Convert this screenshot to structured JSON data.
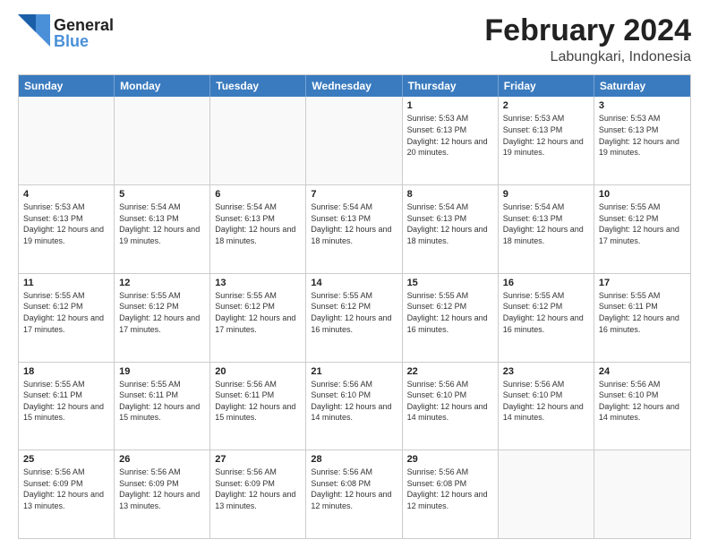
{
  "header": {
    "logo_general": "General",
    "logo_blue": "Blue",
    "month_title": "February 2024",
    "location": "Labungkari, Indonesia"
  },
  "calendar": {
    "days_of_week": [
      "Sunday",
      "Monday",
      "Tuesday",
      "Wednesday",
      "Thursday",
      "Friday",
      "Saturday"
    ],
    "weeks": [
      [
        {
          "day": "",
          "empty": true
        },
        {
          "day": "",
          "empty": true
        },
        {
          "day": "",
          "empty": true
        },
        {
          "day": "",
          "empty": true
        },
        {
          "day": "1",
          "sunrise": "5:53 AM",
          "sunset": "6:13 PM",
          "daylight": "12 hours and 20 minutes."
        },
        {
          "day": "2",
          "sunrise": "5:53 AM",
          "sunset": "6:13 PM",
          "daylight": "12 hours and 19 minutes."
        },
        {
          "day": "3",
          "sunrise": "5:53 AM",
          "sunset": "6:13 PM",
          "daylight": "12 hours and 19 minutes."
        }
      ],
      [
        {
          "day": "4",
          "sunrise": "5:53 AM",
          "sunset": "6:13 PM",
          "daylight": "12 hours and 19 minutes."
        },
        {
          "day": "5",
          "sunrise": "5:54 AM",
          "sunset": "6:13 PM",
          "daylight": "12 hours and 19 minutes."
        },
        {
          "day": "6",
          "sunrise": "5:54 AM",
          "sunset": "6:13 PM",
          "daylight": "12 hours and 18 minutes."
        },
        {
          "day": "7",
          "sunrise": "5:54 AM",
          "sunset": "6:13 PM",
          "daylight": "12 hours and 18 minutes."
        },
        {
          "day": "8",
          "sunrise": "5:54 AM",
          "sunset": "6:13 PM",
          "daylight": "12 hours and 18 minutes."
        },
        {
          "day": "9",
          "sunrise": "5:54 AM",
          "sunset": "6:13 PM",
          "daylight": "12 hours and 18 minutes."
        },
        {
          "day": "10",
          "sunrise": "5:55 AM",
          "sunset": "6:12 PM",
          "daylight": "12 hours and 17 minutes."
        }
      ],
      [
        {
          "day": "11",
          "sunrise": "5:55 AM",
          "sunset": "6:12 PM",
          "daylight": "12 hours and 17 minutes."
        },
        {
          "day": "12",
          "sunrise": "5:55 AM",
          "sunset": "6:12 PM",
          "daylight": "12 hours and 17 minutes."
        },
        {
          "day": "13",
          "sunrise": "5:55 AM",
          "sunset": "6:12 PM",
          "daylight": "12 hours and 17 minutes."
        },
        {
          "day": "14",
          "sunrise": "5:55 AM",
          "sunset": "6:12 PM",
          "daylight": "12 hours and 16 minutes."
        },
        {
          "day": "15",
          "sunrise": "5:55 AM",
          "sunset": "6:12 PM",
          "daylight": "12 hours and 16 minutes."
        },
        {
          "day": "16",
          "sunrise": "5:55 AM",
          "sunset": "6:12 PM",
          "daylight": "12 hours and 16 minutes."
        },
        {
          "day": "17",
          "sunrise": "5:55 AM",
          "sunset": "6:11 PM",
          "daylight": "12 hours and 16 minutes."
        }
      ],
      [
        {
          "day": "18",
          "sunrise": "5:55 AM",
          "sunset": "6:11 PM",
          "daylight": "12 hours and 15 minutes."
        },
        {
          "day": "19",
          "sunrise": "5:55 AM",
          "sunset": "6:11 PM",
          "daylight": "12 hours and 15 minutes."
        },
        {
          "day": "20",
          "sunrise": "5:56 AM",
          "sunset": "6:11 PM",
          "daylight": "12 hours and 15 minutes."
        },
        {
          "day": "21",
          "sunrise": "5:56 AM",
          "sunset": "6:10 PM",
          "daylight": "12 hours and 14 minutes."
        },
        {
          "day": "22",
          "sunrise": "5:56 AM",
          "sunset": "6:10 PM",
          "daylight": "12 hours and 14 minutes."
        },
        {
          "day": "23",
          "sunrise": "5:56 AM",
          "sunset": "6:10 PM",
          "daylight": "12 hours and 14 minutes."
        },
        {
          "day": "24",
          "sunrise": "5:56 AM",
          "sunset": "6:10 PM",
          "daylight": "12 hours and 14 minutes."
        }
      ],
      [
        {
          "day": "25",
          "sunrise": "5:56 AM",
          "sunset": "6:09 PM",
          "daylight": "12 hours and 13 minutes."
        },
        {
          "day": "26",
          "sunrise": "5:56 AM",
          "sunset": "6:09 PM",
          "daylight": "12 hours and 13 minutes."
        },
        {
          "day": "27",
          "sunrise": "5:56 AM",
          "sunset": "6:09 PM",
          "daylight": "12 hours and 13 minutes."
        },
        {
          "day": "28",
          "sunrise": "5:56 AM",
          "sunset": "6:08 PM",
          "daylight": "12 hours and 12 minutes."
        },
        {
          "day": "29",
          "sunrise": "5:56 AM",
          "sunset": "6:08 PM",
          "daylight": "12 hours and 12 minutes."
        },
        {
          "day": "",
          "empty": true
        },
        {
          "day": "",
          "empty": true
        }
      ]
    ]
  }
}
